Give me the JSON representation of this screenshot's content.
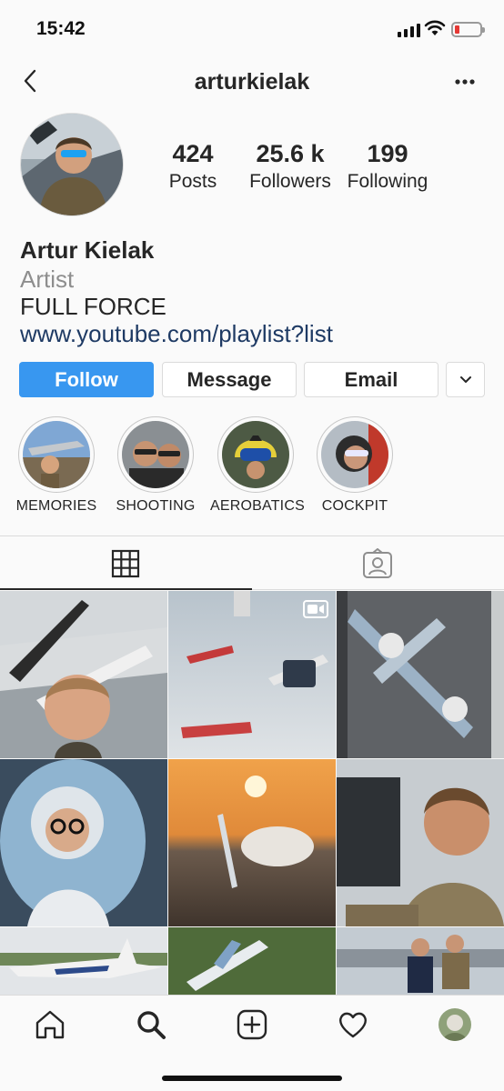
{
  "status_bar": {
    "time": "15:42"
  },
  "header": {
    "username": "arturkielak"
  },
  "profile": {
    "stats": [
      {
        "value": "424",
        "label": "Posts"
      },
      {
        "value": "25.6 k",
        "label": "Followers"
      },
      {
        "value": "199",
        "label": "Following"
      }
    ],
    "name": "Artur Kielak",
    "category": "Artist",
    "bio_line": "FULL FORCE",
    "link": "www.youtube.com/playlist?list"
  },
  "actions": {
    "follow_label": "Follow",
    "message_label": "Message",
    "email_label": "Email",
    "more_icon": "chevron-down-icon"
  },
  "highlights": [
    {
      "label": "MEMORIES"
    },
    {
      "label": "SHOOTING"
    },
    {
      "label": "AEROBATICS"
    },
    {
      "label": "COCKPIT"
    }
  ],
  "tabs": [
    {
      "icon": "grid-icon",
      "active": true
    },
    {
      "icon": "tagged-icon",
      "active": false
    }
  ],
  "nav": [
    "home-icon",
    "search-icon",
    "new-post-icon",
    "activity-icon",
    "profile-avatar"
  ],
  "colors": {
    "accent": "#3897f0",
    "link": "#1e3a64",
    "battery_low": "#e53935"
  }
}
